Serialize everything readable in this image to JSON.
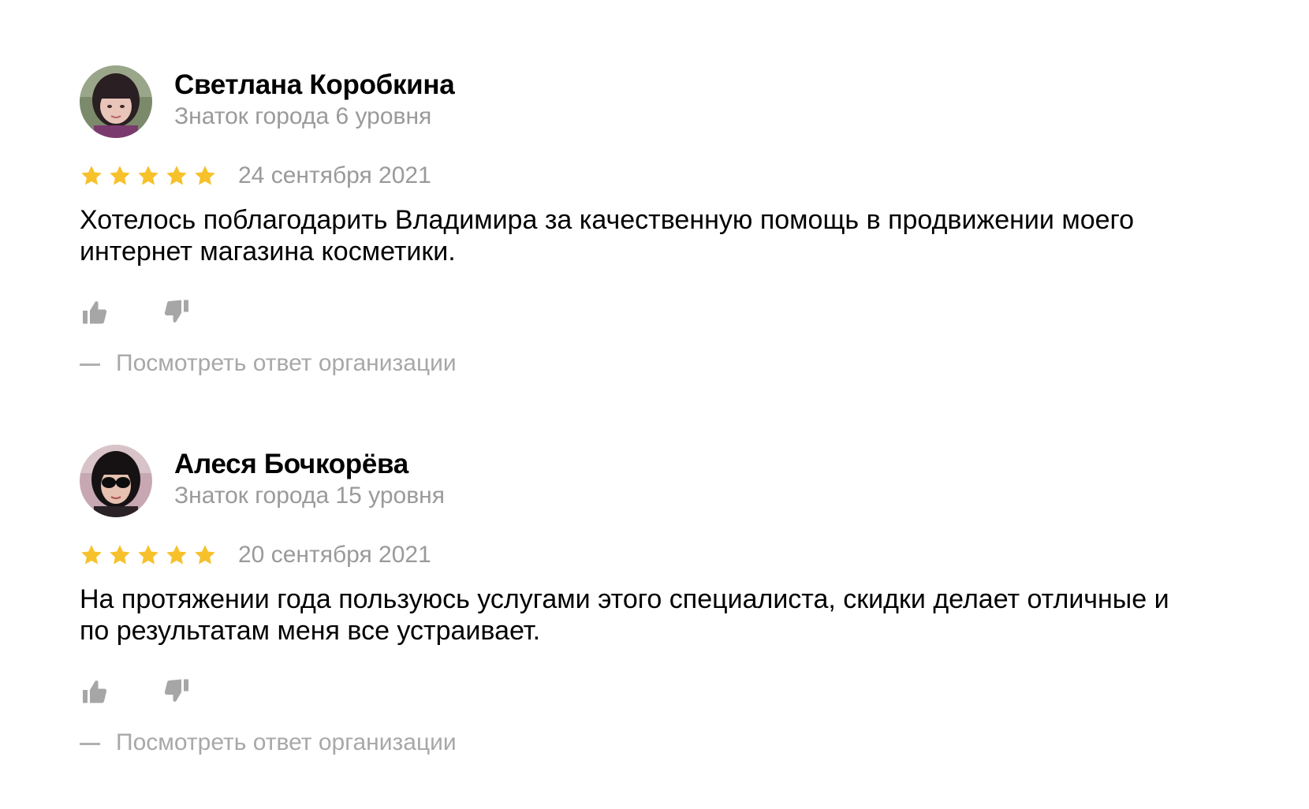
{
  "reviews": [
    {
      "author_name": "Светлана Коробкина",
      "author_level": "Знаток города 6 уровня",
      "rating": 5,
      "rating_max": 5,
      "date": "24 сентября 2021",
      "text": "Хотелось поблагодарить Владимира за качественную помощь в продвижении моего интернет магазина косметики.",
      "org_answer_link": "Посмотреть ответ организации"
    },
    {
      "author_name": "Алеся Бочкорёва",
      "author_level": "Знаток города 15 уровня",
      "rating": 5,
      "rating_max": 5,
      "date": "20 сентября 2021",
      "text": "На протяжении года пользуюсь услугами этого специалиста, скидки делает отличные и по результатам меня все устраивает.",
      "org_answer_link": "Посмотреть ответ организации"
    }
  ],
  "colors": {
    "star": "#f6c12b",
    "secondary_text": "#9a9a9a",
    "link_text": "#a8a8a8",
    "vote_icon": "#a6a6a6"
  },
  "icons": {
    "like": "thumbs-up-icon",
    "dislike": "thumbs-down-icon",
    "rating": "star-icon"
  }
}
